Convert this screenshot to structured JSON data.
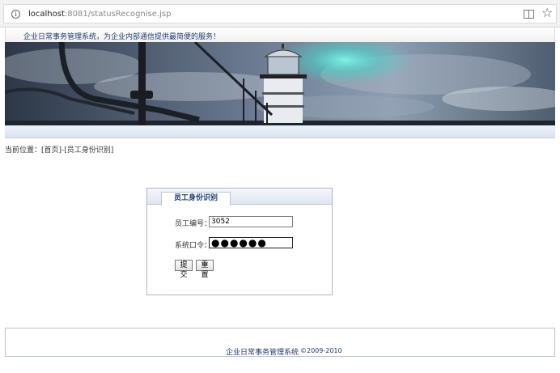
{
  "browser": {
    "url_host": "localhost",
    "url_path": ":8081/statusRecognise.jsp",
    "info_icon": "info-icon",
    "reader_icon": "reader-mode-icon",
    "bookmark_icon": "star-icon"
  },
  "header": {
    "slogan": "企业日常事务管理系统，为企业内部通信提供最简便的服务！",
    "banner": "lighthouse-banner-image"
  },
  "breadcrumb": {
    "prefix": "当前位置：",
    "home": "[首页]",
    "separator": " - ",
    "current": "[员工身份识别]"
  },
  "form": {
    "tab_title": "员工身份识别",
    "employee_id_label": "员工编号：",
    "employee_id_value": "3052",
    "password_label": "系统口令：",
    "password_value": "●●●●●●",
    "submit_label": "提交",
    "reset_label": "重置"
  },
  "footer": {
    "system_name": "企业日常事务管理系统",
    "copyright": "©2009-2010"
  },
  "colors": {
    "accent": "#1d3a6e",
    "border": "#a9b6c8"
  }
}
